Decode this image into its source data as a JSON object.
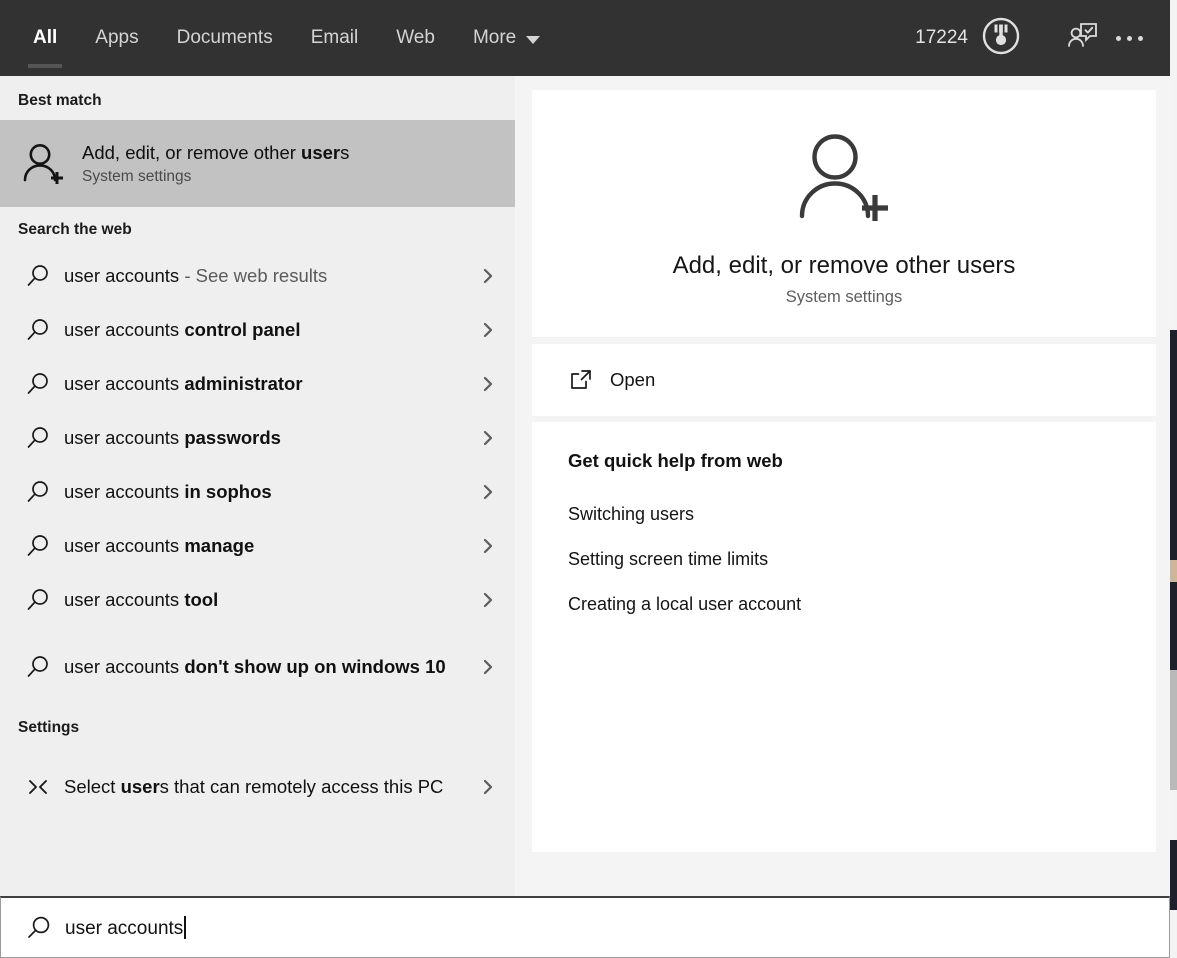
{
  "topbar": {
    "tabs": [
      {
        "label": "All",
        "active": true,
        "has_caret": false
      },
      {
        "label": "Apps",
        "active": false,
        "has_caret": false
      },
      {
        "label": "Documents",
        "active": false,
        "has_caret": false
      },
      {
        "label": "Email",
        "active": false,
        "has_caret": false
      },
      {
        "label": "Web",
        "active": false,
        "has_caret": false
      },
      {
        "label": "More",
        "active": false,
        "has_caret": true
      }
    ],
    "reward_count": "17224",
    "reward_icon": "medal-icon",
    "feedback_icon": "person-feedback-icon",
    "more_icon": "ellipsis-icon",
    "background_color": "#323232"
  },
  "left_pane": {
    "best_match_heading": "Best match",
    "best_match": {
      "icon": "add-user-icon",
      "title_plain": "Add, edit, or remove other ",
      "title_bold": "user",
      "title_tail": "s",
      "subtitle": "System settings",
      "highlight_color": "#c2c2c2"
    },
    "search_web_heading": "Search the web",
    "web_results": [
      {
        "icon": "search-icon",
        "prefix": "user accounts",
        "bold": "",
        "muted": " - See web results"
      },
      {
        "icon": "search-icon",
        "prefix": "user accounts ",
        "bold": "control panel",
        "muted": ""
      },
      {
        "icon": "search-icon",
        "prefix": "user accounts ",
        "bold": "administrator",
        "muted": ""
      },
      {
        "icon": "search-icon",
        "prefix": "user accounts ",
        "bold": "passwords",
        "muted": ""
      },
      {
        "icon": "search-icon",
        "prefix": "user accounts ",
        "bold": "in sophos",
        "muted": ""
      },
      {
        "icon": "search-icon",
        "prefix": "user accounts ",
        "bold": "manage",
        "muted": ""
      },
      {
        "icon": "search-icon",
        "prefix": "user accounts ",
        "bold": "tool",
        "muted": ""
      },
      {
        "icon": "search-icon",
        "prefix": "user accounts ",
        "bold": "don't show up on windows 10",
        "muted": ""
      }
    ],
    "settings_heading": "Settings",
    "settings_results": [
      {
        "icon": "remote-access-icon",
        "prefix": "Select ",
        "bold": "user",
        "suffix": "s that can remotely access this PC"
      }
    ]
  },
  "preview": {
    "hero_icon": "add-user-icon",
    "hero_title": "Add, edit, or remove other users",
    "hero_subtitle": "System settings",
    "open_action": {
      "icon": "open-external-icon",
      "label": "Open"
    },
    "help_title": "Get quick help from web",
    "help_links": [
      "Switching users",
      "Setting screen time limits",
      "Creating a local user account"
    ]
  },
  "search_box": {
    "icon": "search-icon",
    "value": "user accounts",
    "placeholder": "Type here to search"
  },
  "colors": {
    "topbar": "#323232",
    "left_pane": "#efefef",
    "right_pane": "#f4f4f4",
    "card": "#ffffff",
    "highlight": "#c2c2c2"
  }
}
